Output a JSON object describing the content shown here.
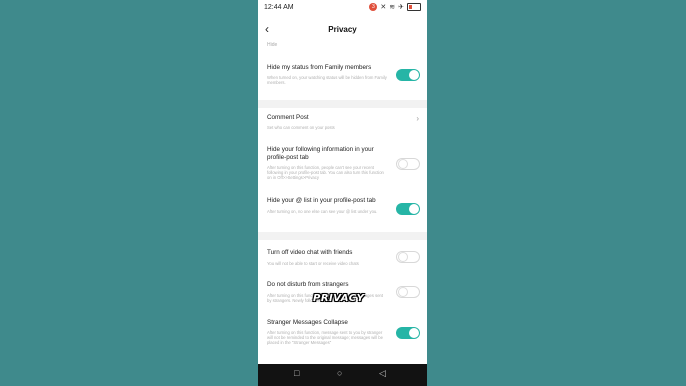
{
  "status_bar": {
    "time": "12:44 AM",
    "notification_count": "3",
    "battery_level": 0.3
  },
  "header": {
    "title": "Privacy",
    "back_icon": "chevron-left-icon"
  },
  "top_cut_label": "Hide",
  "settings": [
    {
      "label": "Hide my status from Family members",
      "desc": "When turned on, your watching status will be hidden from Family members.",
      "control": "toggle",
      "on": true
    },
    {
      "label": "Comment Post",
      "desc": "Set who can comment on your posts",
      "control": "chevron"
    },
    {
      "label": "Hide your following information in your profile-post tab",
      "desc": "After turning on this function, people can't see your recent following in your profile-post tab. You can also turn this function on in Off>>Settings>Privacy",
      "control": "toggle",
      "on": false
    },
    {
      "label": "Hide your @ list in your profile-post tab",
      "desc": "After turning on, no one else can see your @ list under you.",
      "control": "toggle",
      "on": true
    },
    {
      "label": "Turn off video chat with friends",
      "desc": "You will not be able to start or receive video chats",
      "control": "toggle",
      "on": false
    },
    {
      "label": "Do not disturb from strangers",
      "desc": "After turning on this function, you won't receive messages sent by strangers. Newly followers will be ...",
      "control": "toggle",
      "on": false
    },
    {
      "label": "Stranger Messages Collapse",
      "desc": "After turning on this function, message sent to you by stranger will not be reminded to the original message; messages will be placed in the \"Stranger Messages\"",
      "control": "toggle",
      "on": true
    }
  ],
  "video_overlay_text": "PRIVACY",
  "system_nav": {
    "recents_icon": "square-icon",
    "home_icon": "circle-icon",
    "back_icon": "triangle-back-icon"
  },
  "colors": {
    "background": "#3f8a8c",
    "toggle_on": "#26b5a6"
  }
}
